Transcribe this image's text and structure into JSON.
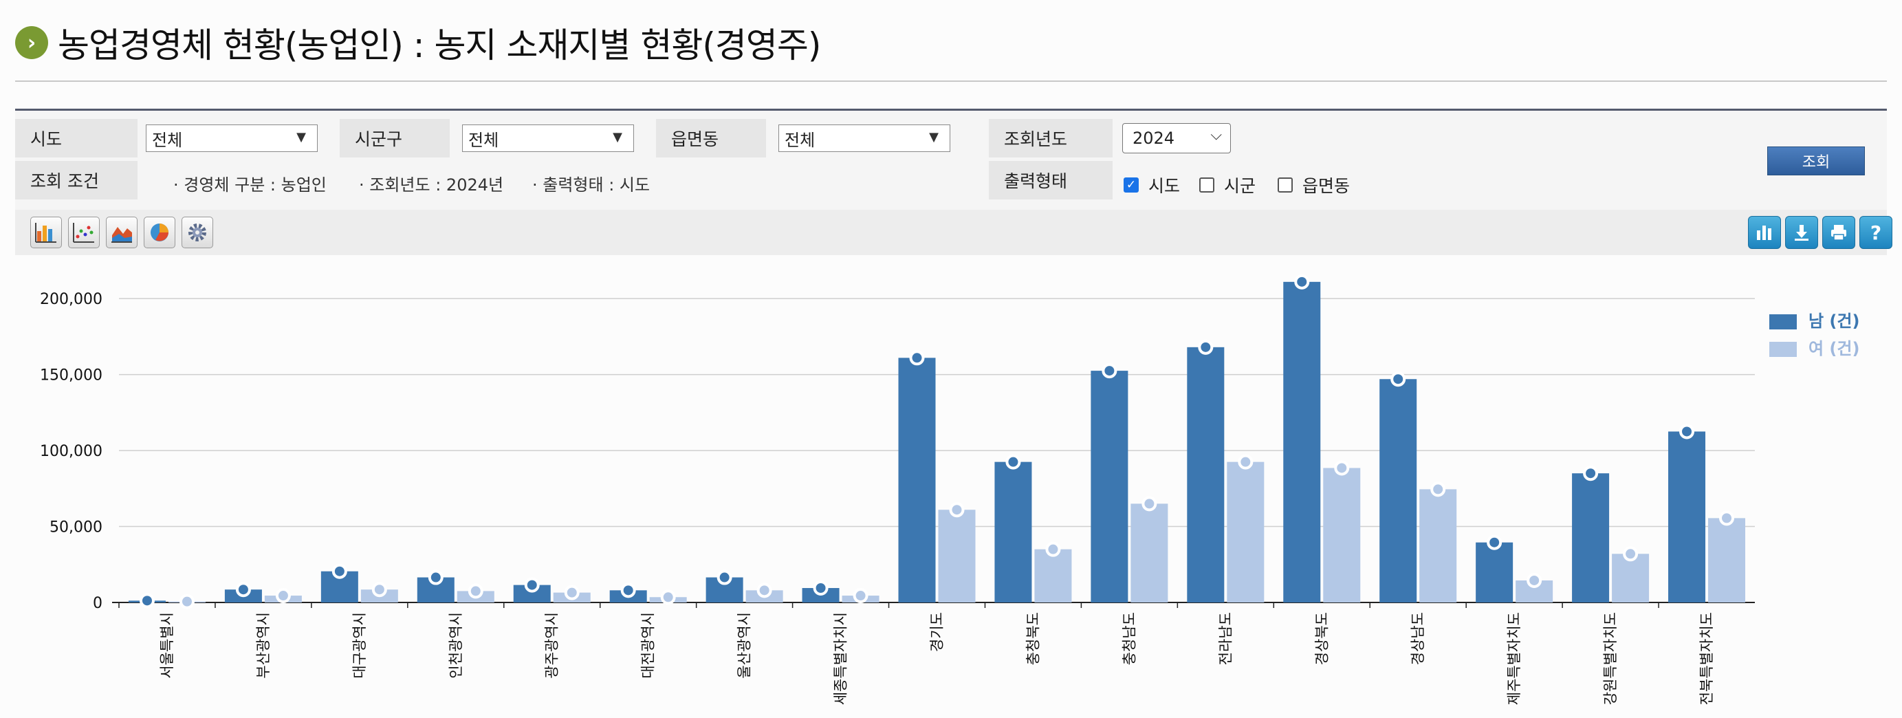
{
  "page": {
    "title": "농업경영체 현황(농업인) : 농지 소재지별 현황(경영주)",
    "title_badge": "›"
  },
  "search": {
    "sido_label": "시도",
    "sido_value": "전체",
    "sigungu_label": "시군구",
    "sigungu_value": "전체",
    "eupmyeondong_label": "읍면동",
    "eupmyeondong_value": "전체",
    "year_label": "조회년도",
    "year_value": "2024",
    "condition_label": "조회 조건",
    "condition_items": [
      "· 경영체 구분 : 농업인",
      "· 조회년도 : 2024년",
      "· 출력형태 : 시도"
    ],
    "output_label": "출력형태",
    "output_options": [
      {
        "label": "시도",
        "checked": true
      },
      {
        "label": "시군",
        "checked": false
      },
      {
        "label": "읍면동",
        "checked": false
      }
    ],
    "query_button": "조회"
  },
  "toolbar": {
    "left_icons": [
      "bar-chart-icon",
      "scatter-chart-icon",
      "area-chart-icon",
      "pie-chart-icon",
      "settings-icon"
    ],
    "right_icons": [
      "bar-chart-icon",
      "download-icon",
      "print-icon",
      "help-icon"
    ],
    "help_glyph": "?"
  },
  "chart_data": {
    "type": "bar",
    "categories": [
      "서울특별시",
      "부산광역시",
      "대구광역시",
      "인천광역시",
      "광주광역시",
      "대전광역시",
      "울산광역시",
      "세종특별자치시",
      "경기도",
      "충청북도",
      "충청남도",
      "전라남도",
      "경상북도",
      "경상남도",
      "제주특별자치도",
      "강원특별자치도",
      "전북특별자치도"
    ],
    "series": [
      {
        "name": "남 (건)",
        "color": "#3c77b0",
        "values": [
          1200,
          8500,
          20500,
          16500,
          11500,
          8000,
          16500,
          9500,
          161000,
          92500,
          152500,
          168000,
          211000,
          147000,
          39500,
          85000,
          112500
        ]
      },
      {
        "name": "여 (건)",
        "color": "#b3c8e6",
        "values": [
          600,
          4500,
          8500,
          7500,
          6500,
          3500,
          8000,
          4500,
          61000,
          35000,
          65000,
          92500,
          88500,
          74500,
          14500,
          32000,
          55500
        ]
      }
    ],
    "y_ticks": [
      "0",
      "50,000",
      "100,000",
      "150,000",
      "200,000"
    ],
    "ylim": [
      0,
      215000
    ],
    "legend_position": "top-right",
    "grid": true
  }
}
